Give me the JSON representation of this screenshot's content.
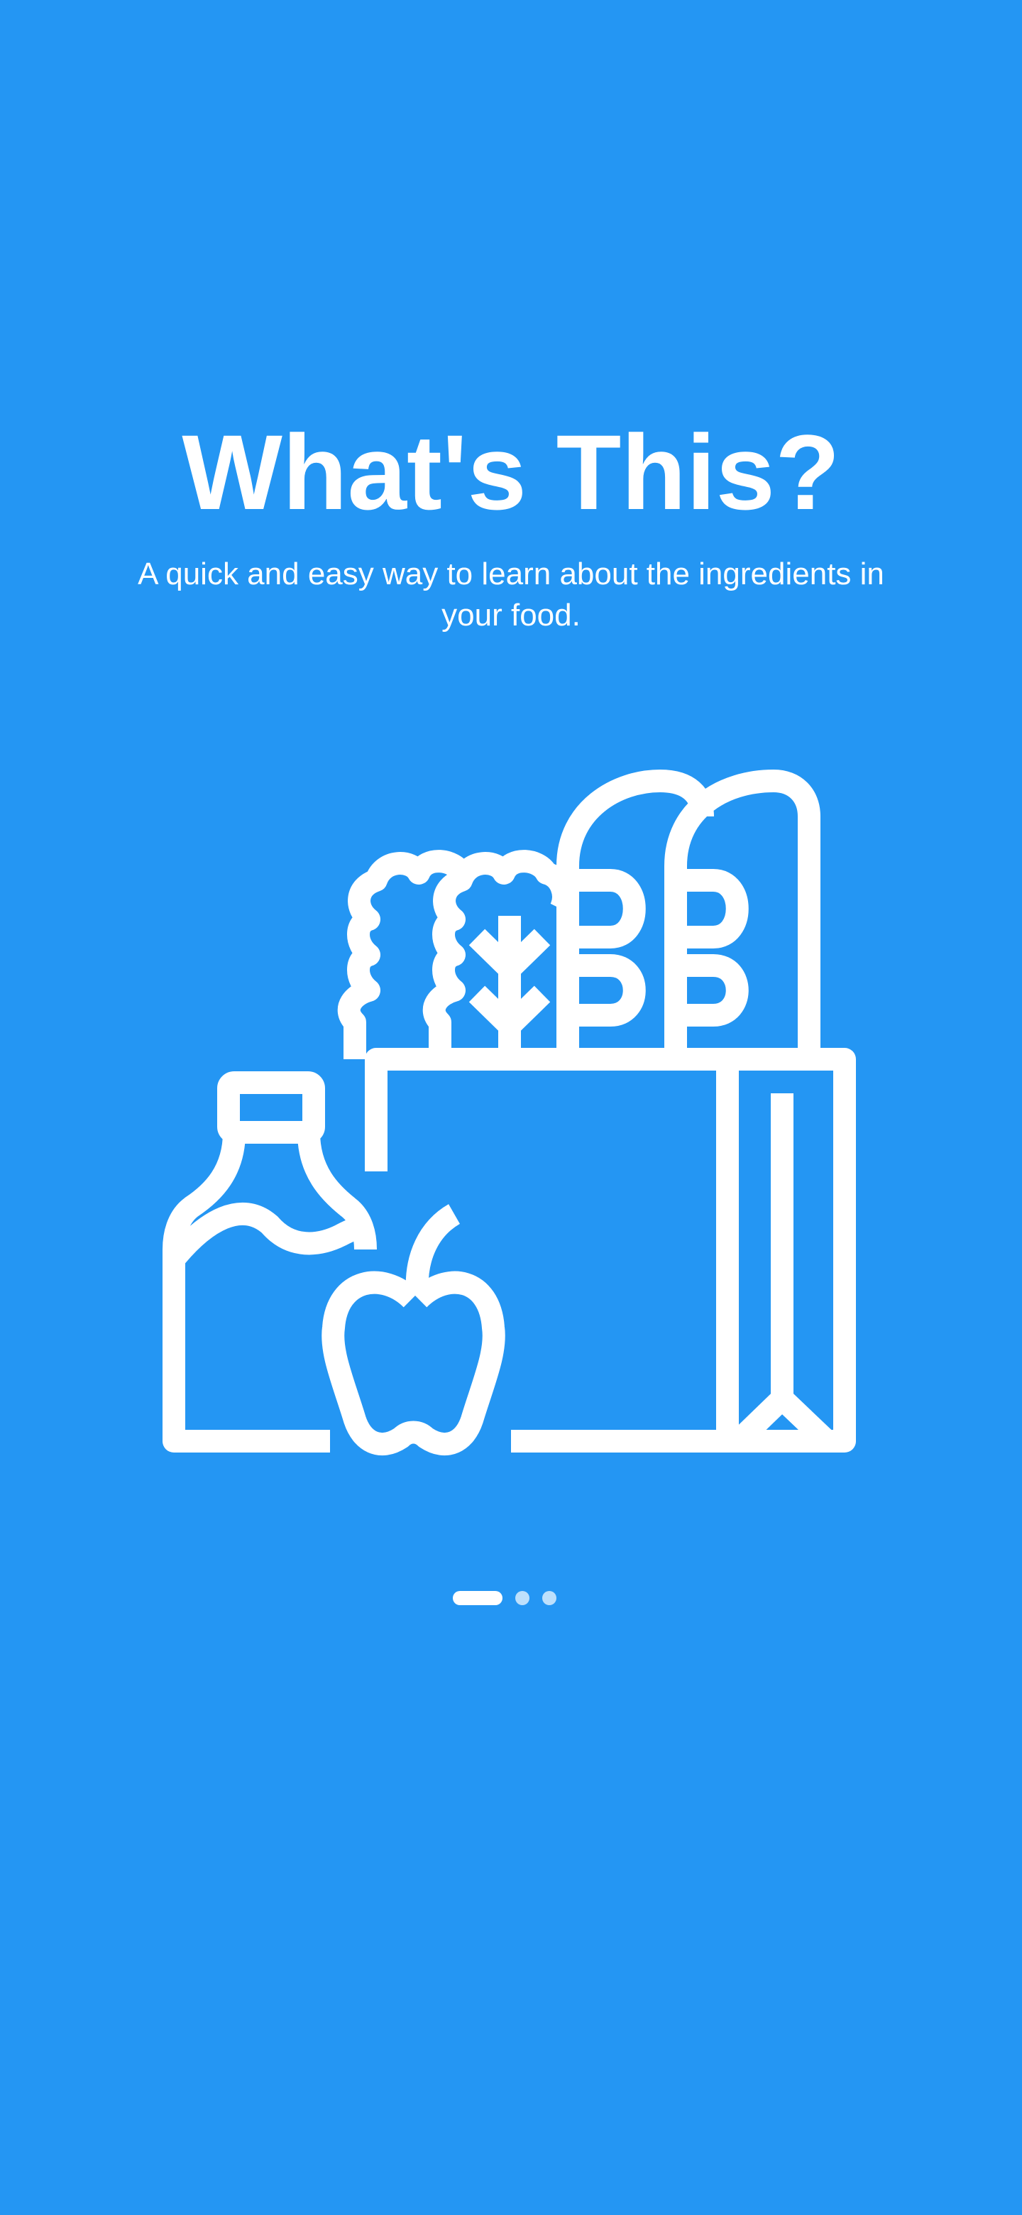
{
  "onboarding": {
    "title": "What's This?",
    "subtitle": "A quick and easy way to learn about the ingredients in your food.",
    "illustration_icon": "grocery-bag-icon",
    "page_indicator": {
      "total_pages": 3,
      "current_page": 1
    }
  },
  "colors": {
    "background": "#2496F3",
    "foreground": "#FFFFFF"
  }
}
